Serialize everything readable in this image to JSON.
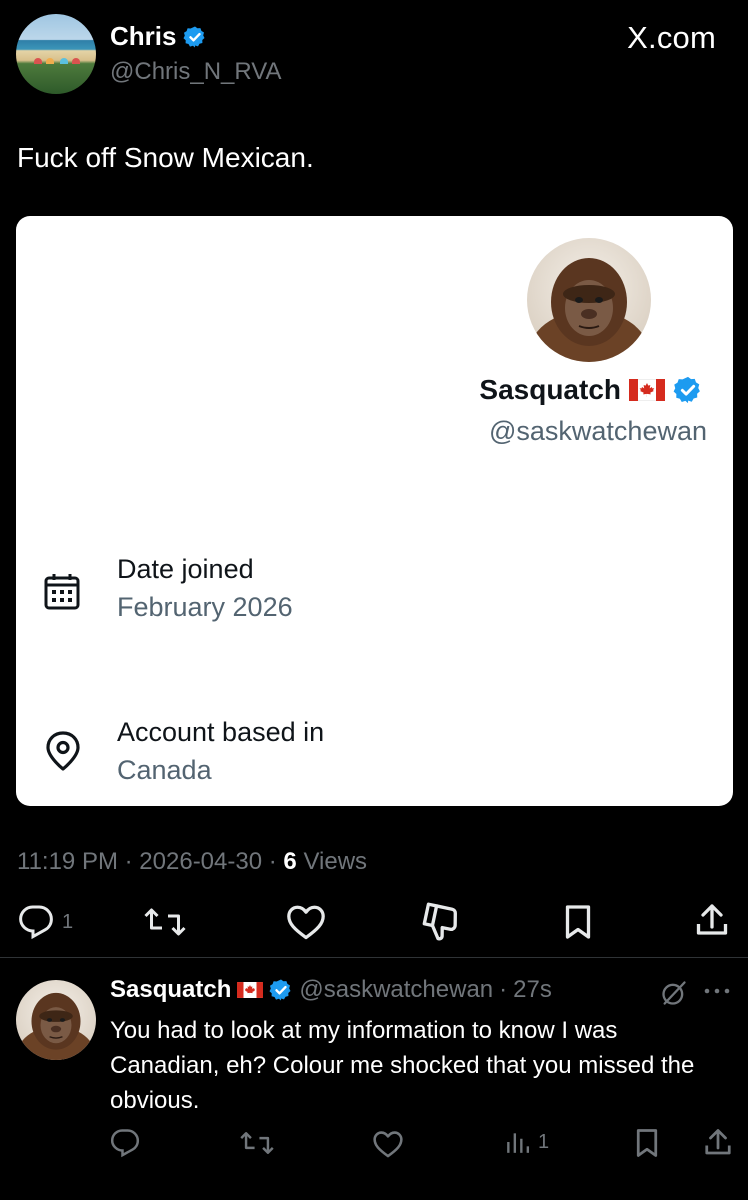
{
  "header": {
    "name": "Chris",
    "handle": "@Chris_N_RVA",
    "brand": "X.com"
  },
  "tweet": {
    "text": "Fuck off Snow Mexican."
  },
  "card": {
    "name": "Sasquatch",
    "handle": "@saskwatchewan",
    "date_joined_label": "Date joined",
    "date_joined_value": "February 2026",
    "location_label": "Account based in",
    "location_value": "Canada"
  },
  "meta": {
    "time": "11:19 PM",
    "date": "2026-04-30",
    "views_count": "6",
    "views_label": "Views"
  },
  "actions": {
    "reply_count": "1"
  },
  "reply": {
    "name": "Sasquatch",
    "handle": "@saskwatchewan",
    "time": "27s",
    "text": "You had to look at my information to know I was Canadian, eh? Colour me shocked that you missed the obvious.",
    "views_count": "1"
  },
  "icons": {
    "verified": "verified-badge-icon",
    "flag": "canada-flag-icon",
    "calendar": "calendar-icon",
    "location": "location-pin-icon",
    "reply": "reply-icon",
    "retweet": "retweet-icon",
    "like": "heart-icon",
    "dislike": "dislike-icon",
    "bookmark": "bookmark-icon",
    "share": "share-icon",
    "grok": "grok-icon",
    "more": "more-icon",
    "views": "views-icon"
  },
  "colors": {
    "background": "#000000",
    "verified": "#1d9bf0",
    "muted": "#71767b",
    "flag_red": "#d52b1e"
  }
}
